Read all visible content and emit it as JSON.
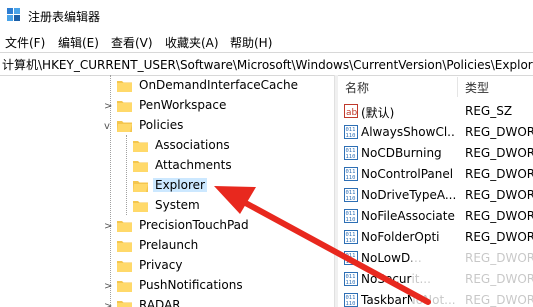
{
  "window": {
    "title": "注册表编辑器"
  },
  "menu": [
    "文件(F)",
    "编辑(E)",
    "查看(V)",
    "收藏夹(A)",
    "帮助(H)"
  ],
  "address": "计算机\\HKEY_CURRENT_USER\\Software\\Microsoft\\Windows\\CurrentVersion\\Policies\\Explorer",
  "tree": [
    {
      "label": "OnDemandInterfaceCache",
      "expander": ""
    },
    {
      "label": "PenWorkspace",
      "expander": ">"
    },
    {
      "label": "Policies",
      "expander": "v"
    },
    {
      "label": "Associations",
      "expander": ""
    },
    {
      "label": "Attachments",
      "expander": ""
    },
    {
      "label": "Explorer",
      "expander": ""
    },
    {
      "label": "System",
      "expander": ""
    },
    {
      "label": "PrecisionTouchPad",
      "expander": ">"
    },
    {
      "label": "Prelaunch",
      "expander": ""
    },
    {
      "label": "Privacy",
      "expander": ""
    },
    {
      "label": "PushNotifications",
      "expander": ">"
    },
    {
      "label": "RADAR",
      "expander": ">"
    }
  ],
  "list": {
    "headers": {
      "name": "名称",
      "type": "类型"
    },
    "rows": [
      {
        "name": "(默认)",
        "type": "REG_SZ",
        "icon": "string-value-icon"
      },
      {
        "name": "AlwaysShowCl...",
        "type": "REG_DWOR",
        "icon": "binary-value-icon"
      },
      {
        "name": "NoCDBurning",
        "type": "REG_DWOR",
        "icon": "binary-value-icon"
      },
      {
        "name": "NoControlPanel",
        "type": "REG_DWOR",
        "icon": "binary-value-icon"
      },
      {
        "name": "NoDriveTypeA...",
        "type": "REG_DWOR",
        "icon": "binary-value-icon"
      },
      {
        "name": "NoFileAssociate",
        "type": "REG_DWOR",
        "icon": "binary-value-icon"
      },
      {
        "name": "NoFolderOpti",
        "type": "REG_DWOR",
        "icon": "binary-value-icon"
      },
      {
        "name": "NoLowD...",
        "type": "REG_DWOR",
        "icon": "binary-value-icon"
      },
      {
        "name": "NoSecurit...",
        "type": "REG_DWOR",
        "icon": "binary-value-icon"
      },
      {
        "name": "TaskbarNoNot...",
        "type": "REG_DWOR",
        "icon": "binary-value-icon"
      }
    ]
  },
  "colors": {
    "selection": "#cce8ff",
    "folder": "#f4c64e",
    "arrow": "#e8281e"
  }
}
